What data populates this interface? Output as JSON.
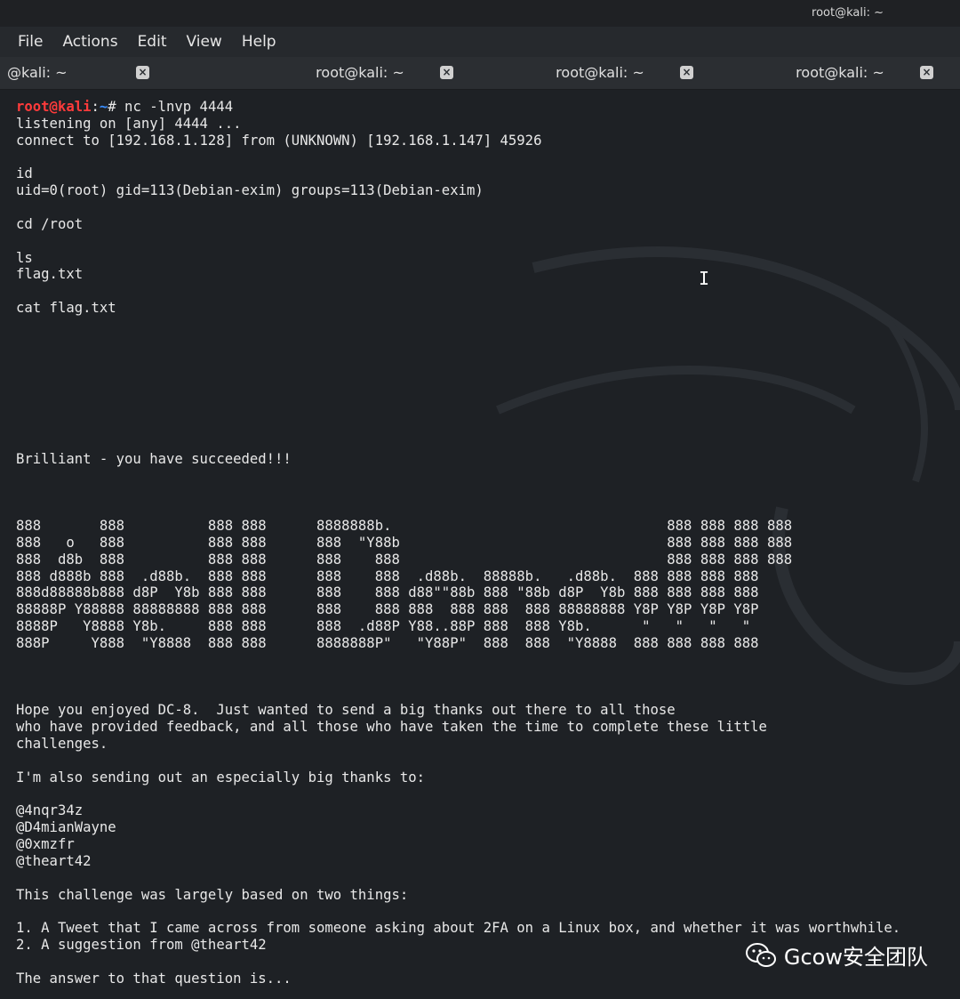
{
  "window": {
    "title": "root@kali: ~"
  },
  "menu": [
    "File",
    "Actions",
    "Edit",
    "View",
    "Help"
  ],
  "tabs": [
    {
      "label": "@kali: ~"
    },
    {
      "label": "root@kali: ~"
    },
    {
      "label": "root@kali: ~"
    },
    {
      "label": "root@kali: ~"
    }
  ],
  "terminal": {
    "prompt_user": "root@kali",
    "prompt_sep": ":",
    "prompt_path": "~",
    "prompt_end": "# nc -lnvp 4444",
    "lines": [
      "listening on [any] 4444 ...",
      "connect to [192.168.1.128] from (UNKNOWN) [192.168.1.147] 45926",
      "",
      "id",
      "uid=0(root) gid=113(Debian-exim) groups=113(Debian-exim)",
      "",
      "cd /root",
      "",
      "ls",
      "flag.txt",
      "",
      "cat flag.txt",
      "",
      "",
      "",
      "",
      "",
      "",
      "",
      "",
      "Brilliant - you have succeeded!!!",
      "",
      "",
      "",
      "888       888          888 888      8888888b.                                 888 888 888 888",
      "888   o   888          888 888      888  \"Y88b                                888 888 888 888",
      "888  d8b  888          888 888      888    888                                888 888 888 888",
      "888 d888b 888  .d88b.  888 888      888    888  .d88b.  88888b.   .d88b.  888 888 888 888",
      "888d88888b888 d8P  Y8b 888 888      888    888 d88\"\"88b 888 \"88b d8P  Y8b 888 888 888 888",
      "88888P Y88888 88888888 888 888      888    888 888  888 888  888 88888888 Y8P Y8P Y8P Y8P",
      "8888P   Y8888 Y8b.     888 888      888  .d88P Y88..88P 888  888 Y8b.      \"   \"   \"   \"",
      "888P     Y888  \"Y8888  888 888      8888888P\"   \"Y88P\"  888  888  \"Y8888  888 888 888 888",
      "",
      "",
      "",
      "Hope you enjoyed DC-8.  Just wanted to send a big thanks out there to all those",
      "who have provided feedback, and all those who have taken the time to complete these little",
      "challenges.",
      "",
      "I'm also sending out an especially big thanks to:",
      "",
      "@4nqr34z",
      "@D4mianWayne",
      "@0xmzfr",
      "@theart42",
      "",
      "This challenge was largely based on two things:",
      "",
      "1. A Tweet that I came across from someone asking about 2FA on a Linux box, and whether it was worthwhile.",
      "2. A suggestion from @theart42",
      "",
      "The answer to that question is..."
    ]
  },
  "watermark": {
    "text": "Gcow安全团队",
    "icon": "wechat-icon"
  },
  "colors": {
    "prompt_user": "#ff3b3b",
    "prompt_path": "#3b8fff",
    "background": "#1e2125"
  }
}
